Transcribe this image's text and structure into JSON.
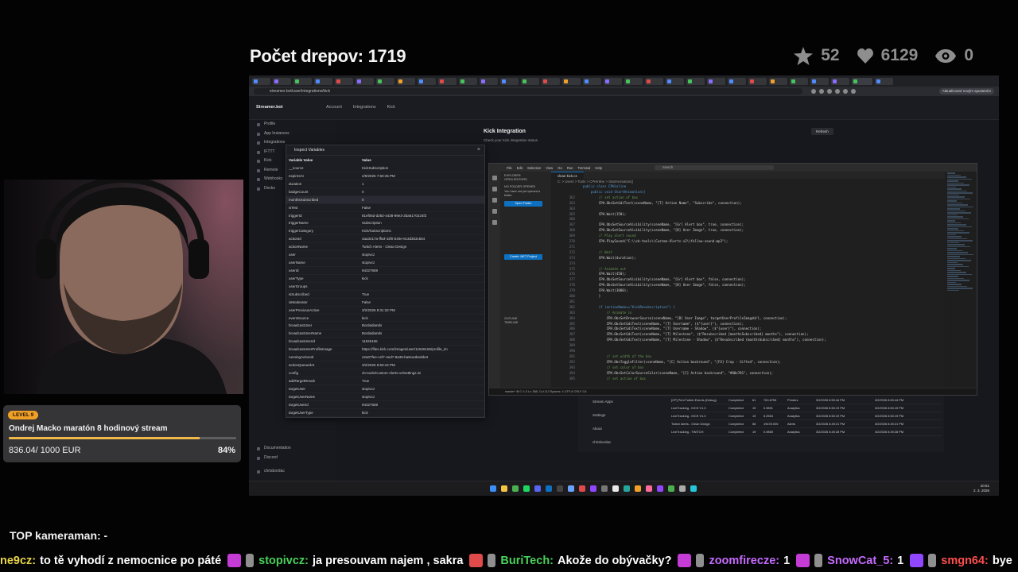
{
  "overlay": {
    "drepy": "Počet drepov: 1719",
    "stats": [
      {
        "icon": "star-icon",
        "value": "52"
      },
      {
        "icon": "heart-icon",
        "value": "6129"
      },
      {
        "icon": "eye-icon",
        "value": "0"
      }
    ],
    "top_kameraman": "TOP kameraman: -"
  },
  "goal": {
    "level": "LEVEL 9",
    "title": "Ondrej Macko maratón 8 hodinový stream",
    "amount": "836.04",
    "target": "/ 1000 EUR",
    "percent": "84%",
    "progress": 0.84
  },
  "browser": {
    "url": "streamer.bot/user/integrations/kick",
    "update_label": "Aktualizovať novým spustením"
  },
  "streamerbot": {
    "logo": "Streamer.bot",
    "nav": [
      "Account",
      "Integrations",
      "Kick"
    ],
    "sidebar": [
      "Profile",
      "App Instances",
      "Integrations",
      "IFTTT",
      "Kick",
      "Remote",
      "Webhooks",
      "Decks"
    ],
    "sidebar_bottom": [
      "Documentation",
      "Discord",
      "chrisbordac"
    ],
    "kick_title": "Kick Integration",
    "kick_subtitle": "Check your Kick integration status",
    "refresh": "Refresh",
    "lower_menu": [
      "Stream Apps",
      "Settings",
      "About",
      "chrisbordac"
    ]
  },
  "inspect": {
    "title": "Inspect Variables",
    "col_key": "Variable Value",
    "col_val": "Value",
    "rows": [
      [
        "__source",
        "KickSubscription"
      ],
      [
        "expiresAt",
        "4/9/2026 7:50:45 PM"
      ],
      [
        "duration",
        "1"
      ],
      [
        "badgeCount",
        "0"
      ],
      [
        "monthsSubscribed",
        "0"
      ],
      [
        "isTest",
        "False"
      ],
      [
        "triggerId",
        "81ef06d-d282-4438-99e3-2ba6170224f3"
      ],
      [
        "triggerName",
        "Subscription"
      ],
      [
        "triggerCategory",
        "Kick/Subscriptions"
      ],
      [
        "actionId",
        "4aa3417a-ff5d-43f0-b40e-8c3d353c564"
      ],
      [
        "actionName",
        "Twitch Alerts - Clean Design"
      ],
      [
        "user",
        "stopivcz"
      ],
      [
        "userName",
        "stopivcz"
      ],
      [
        "userId",
        "94327659"
      ],
      [
        "userType",
        "kick"
      ],
      [
        "userGroups",
        ""
      ],
      [
        "isSubscribed",
        "True"
      ],
      [
        "isModerator",
        "False"
      ],
      [
        "userPreviousActive",
        "3/2/2026 8:31:32 PM"
      ],
      [
        "eventSource",
        "kick"
      ],
      [
        "broadcastUser",
        "Bordadiands"
      ],
      [
        "broadcastUserName",
        "Bordadiands"
      ],
      [
        "broadcastUserId",
        "11526165"
      ],
      [
        "broadcastUserProfileImage",
        "https://files.kick.com/images/user/11526165/profile_im"
      ],
      [
        "runningActionId",
        "42a07fee-cef7-4ed7-8a39-ba8ca4bedde3"
      ],
      [
        "actionQueuedAt",
        "3/2/2026 8:50:44 PM"
      ],
      [
        "config",
        "cb-tools/Custom-Alerts-v2/settings.ini"
      ],
      [
        "addTargetResult",
        "True"
      ],
      [
        "targetUser",
        "stopivcz"
      ],
      [
        "targetUserName",
        "stopivcz"
      ],
      [
        "targetUserId",
        "94327659"
      ],
      [
        "targetUserType",
        "kick"
      ]
    ]
  },
  "vscode": {
    "menu": [
      "File",
      "Edit",
      "Selection",
      "View",
      "Go",
      "Run",
      "Terminal",
      "Help"
    ],
    "search": "Search",
    "explorer_title": "EXPLORER",
    "open_editors": "OPEN EDITORS",
    "no_folder_title": "NO FOLDER OPENED",
    "no_folder_text": "You have not yet opened a folder.",
    "open_folder": "Open Folder",
    "create_project": "Create .NET Project",
    "outline": "OUTLINE",
    "timeline": "TIMELINE",
    "tab": "clean-kick.cs",
    "breadcrumb": "C: > Users > Tools > CPHinline > StartAnimation()",
    "status": "master*  ⊗ 0 ⚠ 0    Ln 388, Col 113   Spaces: 4   UTF-8   CRLF   C#",
    "code": [
      {
        "n": "",
        "t": "public class CPHinline",
        "c": "kw"
      },
      {
        "n": "",
        "t": "    public void StartAnimation()",
        "c": "kw"
      },
      {
        "n": "362",
        "t": "        // set action of box",
        "c": "com"
      },
      {
        "n": "363",
        "t": "        CPH.ObsSetGdiText(sceneName, \"[T] Action Name\", \"Subscribe\", connection);",
        "c": ""
      },
      {
        "n": "364",
        "t": "",
        "c": ""
      },
      {
        "n": "365",
        "t": "        CPH.Wait(150);",
        "c": ""
      },
      {
        "n": "366",
        "t": "",
        "c": ""
      },
      {
        "n": "367",
        "t": "        CPH.ObsSetSourceVisibility(sceneName, \"[Gr] Alert box\", true, connection);",
        "c": ""
      },
      {
        "n": "368",
        "t": "        CPH.ObsSetSourceVisibility(sceneName, \"[B] User Image\", true, connection);",
        "c": ""
      },
      {
        "n": "369",
        "t": "        // Play alert sound",
        "c": "com"
      },
      {
        "n": "370",
        "t": "        CPH.PlaySound(\"C:\\\\cb-tools\\\\Custom-Alerts-v2\\\\follow-sound.mp3\");",
        "c": ""
      },
      {
        "n": "371",
        "t": "",
        "c": ""
      },
      {
        "n": "372",
        "t": "        // Wait",
        "c": "com"
      },
      {
        "n": "373",
        "t": "        CPH.Wait(duration);",
        "c": ""
      },
      {
        "n": "374",
        "t": "",
        "c": ""
      },
      {
        "n": "375",
        "t": "        // Animate out",
        "c": "com"
      },
      {
        "n": "376",
        "t": "        CPH.Wait(450);",
        "c": ""
      },
      {
        "n": "377",
        "t": "        CPH.ObsSetSourceVisibility(sceneName, \"[Gr] Alert box\", false, connection);",
        "c": ""
      },
      {
        "n": "378",
        "t": "        CPH.ObsSetSourceVisibility(sceneName, \"[B] User Image\", false, connection);",
        "c": ""
      },
      {
        "n": "379",
        "t": "        CPH.Wait(3000);",
        "c": ""
      },
      {
        "n": "380",
        "t": "        }",
        "c": ""
      },
      {
        "n": "381",
        "t": "",
        "c": ""
      },
      {
        "n": "382",
        "t": "        if (actionName==\"KickResubscription\") {",
        "c": "kw"
      },
      {
        "n": "383",
        "t": "            // Animate in",
        "c": "com"
      },
      {
        "n": "384",
        "t": "            CPH.ObsSetBrowserSource(sceneName, \"[B] User Image\", targetUserProfileImageUrl, connection);",
        "c": ""
      },
      {
        "n": "385",
        "t": "            CPH.ObsSetGdiText(sceneName, \"[T] Username\", ($\"{user}\"), connection);",
        "c": ""
      },
      {
        "n": "386",
        "t": "            CPH.ObsSetGdiText(sceneName, \"[T] Username - Shadow\", ($\"{user}\"), connection);",
        "c": ""
      },
      {
        "n": "387",
        "t": "            CPH.ObsSetGdiText(sceneName, \"[T] Milestone\", ($\"Resubscribed {monthsSubscribed} months\"), connection);",
        "c": ""
      },
      {
        "n": "388",
        "t": "            CPH.ObsSetGdiText(sceneName, \"[T] Milestone - Shadow\", ($\"Resubscribed {monthsSubscribed} months\"), connection);",
        "c": ""
      },
      {
        "n": "389",
        "t": "",
        "c": ""
      },
      {
        "n": "390",
        "t": "",
        "c": ""
      },
      {
        "n": "391",
        "t": "            // set width of the box",
        "c": "com"
      },
      {
        "n": "392",
        "t": "            CPH.ObsToggleFilter(sceneName, \"[C] Action backround\", \"[FX] Crop - Gifted\", connection);",
        "c": ""
      },
      {
        "n": "393",
        "t": "            // set color of box",
        "c": "com"
      },
      {
        "n": "394",
        "t": "            CPH.ObsSetColorSourceColor(sceneName, \"[C] Action backround\", \"#00e701\", connection);",
        "c": ""
      },
      {
        "n": "395",
        "t": "            // set action of box",
        "c": "com"
      }
    ]
  },
  "actions_grid": [
    [
      "[CP] Print Twitch Events (Debug)",
      "Completed",
      "61",
      "700.8755",
      "Printers",
      "3/2/2026 8:50:44 PM",
      "3/2/2026 8:50:44 PM"
    ],
    [
      "LiveTracking - KICK V1.0",
      "Completed",
      "19",
      "0.9891",
      "Analytics",
      "3/2/2026 8:50:19 PM",
      "3/2/2026 8:50:19 PM"
    ],
    [
      "LiveTracking - KICK V1.0",
      "Completed",
      "19",
      "5.2554",
      "Analytics",
      "3/2/2026 8:50:19 PM",
      "3/2/2026 8:50:19 PM"
    ],
    [
      "Twitch Alerts - Clean Design",
      "Completed",
      "56",
      "19478.925",
      "Alerts",
      "3/2/2026 8:49:21 PM",
      "3/2/2026 8:49:21 PM"
    ],
    [
      "LiveTracking - TWITCH",
      "Completed",
      "19",
      "0.9869",
      "Analytics",
      "3/2/2026 8:49:28 PM",
      "3/2/2026 8:49:28 PM"
    ]
  ],
  "taskbar": {
    "time": "20:51",
    "date": "2. 3. 2026",
    "lang": "SLK"
  },
  "chat": [
    {
      "user": "ne9cz:",
      "user_color": "#e8d54a",
      "text": "to tě vyhodí z nemocnice po páté"
    },
    {
      "user": "stopivcz:",
      "user_color": "#4bd05b",
      "text": "ja presouvam najem , sakra"
    },
    {
      "user": "BuriTech:",
      "user_color": "#4bd05b",
      "text": "Akože do obývačky?"
    },
    {
      "user": "zoomfirecze:",
      "user_color": "#c76bff",
      "text": "1"
    },
    {
      "user": "SnowCat_5:",
      "user_color": "#c76bff",
      "text": "1"
    },
    {
      "user": "smgn64:",
      "user_color": "#ff4d4d",
      "text": "bye"
    }
  ],
  "colors": {
    "accent_orange": "#f0a026",
    "goal_fill": "#f0b84a",
    "vscode_blue": "#0e70c0"
  }
}
